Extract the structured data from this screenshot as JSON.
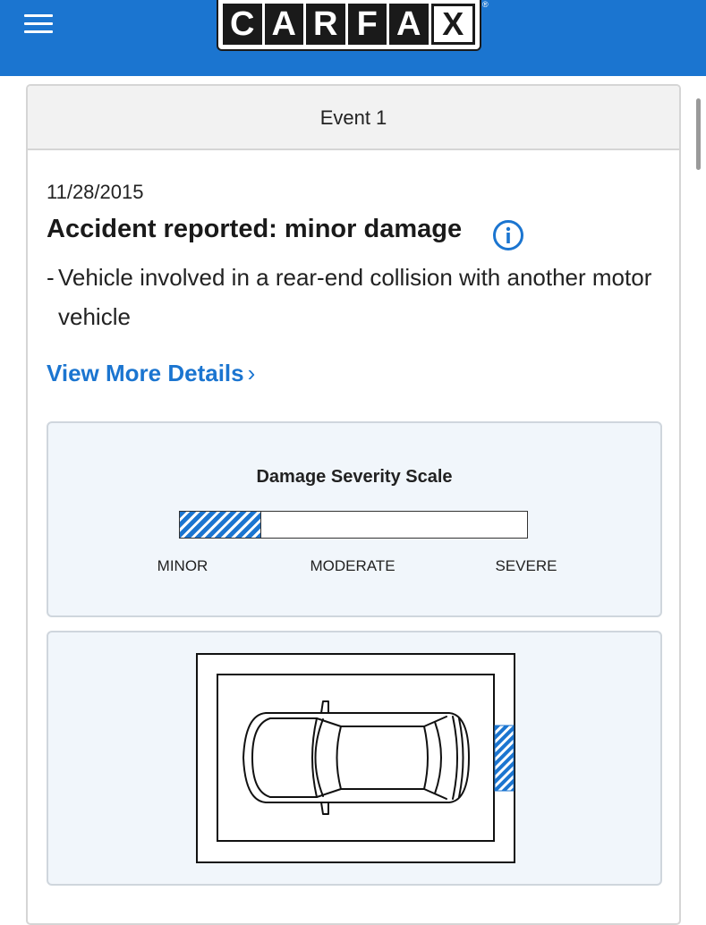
{
  "header": {
    "menu_icon": "hamburger-menu-icon",
    "logo_letters": [
      "C",
      "A",
      "R",
      "F",
      "A",
      "X"
    ],
    "logo_mark": "®",
    "brand_color": "#1b75d0"
  },
  "event": {
    "title": "Event 1",
    "date": "11/28/2015",
    "headline": "Accident reported: minor damage",
    "info_icon": "info-circle-icon",
    "detail_dash": "-",
    "detail": "Vehicle involved in a rear-end collision with another motor vehicle",
    "view_more": "View More Details",
    "view_more_icon": "chevron-right-icon"
  },
  "severity": {
    "title": "Damage Severity Scale",
    "level": 0.235,
    "labels": [
      "MINOR",
      "MODERATE",
      "SEVERE"
    ],
    "fill_color": "#1b75d0"
  },
  "damage_diagram": {
    "vehicle_icon": "car-top-view-icon",
    "damaged_area": "rear",
    "highlight_color": "#1b75d0"
  }
}
